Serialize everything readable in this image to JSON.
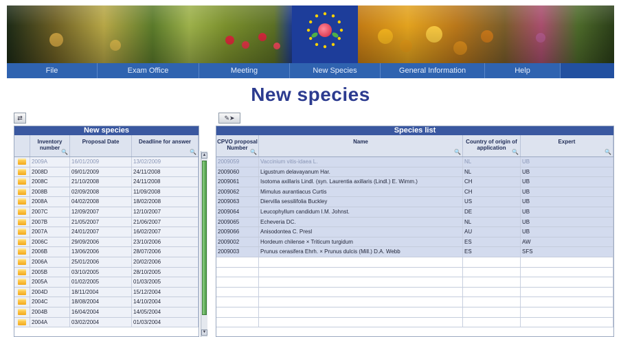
{
  "menu": [
    "File",
    "Exam Office",
    "Meeting",
    "New Species",
    "General Information",
    "Help"
  ],
  "page_title": "New species",
  "left_panel": {
    "title": "New species",
    "columns": [
      "Inventory number",
      "Proposal Date",
      "Deadline for answer"
    ],
    "selected_index": 0,
    "rows": [
      [
        "2009A",
        "16/01/2009",
        "13/02/2009"
      ],
      [
        "2008D",
        "09/01/2009",
        "24/11/2008"
      ],
      [
        "2008C",
        "21/10/2008",
        "24/11/2008"
      ],
      [
        "2008B",
        "02/09/2008",
        "11/09/2008"
      ],
      [
        "2008A",
        "04/02/2008",
        "18/02/2008"
      ],
      [
        "2007C",
        "12/09/2007",
        "12/10/2007"
      ],
      [
        "2007B",
        "21/05/2007",
        "21/06/2007"
      ],
      [
        "2007A",
        "24/01/2007",
        "16/02/2007"
      ],
      [
        "2006C",
        "29/09/2006",
        "23/10/2006"
      ],
      [
        "2006B",
        "13/06/2006",
        "28/07/2006"
      ],
      [
        "2006A",
        "25/01/2006",
        "20/02/2006"
      ],
      [
        "2005B",
        "03/10/2005",
        "28/10/2005"
      ],
      [
        "2005A",
        "01/02/2005",
        "01/03/2005"
      ],
      [
        "2004D",
        "18/11/2004",
        "15/12/2004"
      ],
      [
        "2004C",
        "18/08/2004",
        "14/10/2004"
      ],
      [
        "2004B",
        "16/04/2004",
        "14/05/2004"
      ],
      [
        "2004A",
        "03/02/2004",
        "01/03/2004"
      ]
    ]
  },
  "right_panel": {
    "title": "Species list",
    "columns": [
      "CPVO proposal Number",
      "Name",
      "Country of origin of application",
      "Expert"
    ],
    "selected_index": 0,
    "empty_rows": 7,
    "rows": [
      [
        "2009059",
        "Vaccinium vitis-idaea L.",
        "NL",
        "UB"
      ],
      [
        "2009060",
        "Ligustrum delavayanum Har.",
        "NL",
        "UB"
      ],
      [
        "2009061",
        "Isotoma axillaris Lindl. (syn. Laurentia axillaris (Lindl.) E. Wimm.)",
        "CH",
        "UB"
      ],
      [
        "2009062",
        "Mimulus aurantiacus Curtis",
        "CH",
        "UB"
      ],
      [
        "2009063",
        "Diervilla sessilifolia Buckley",
        "US",
        "UB"
      ],
      [
        "2009064",
        "Leucophyllum candidum I.M. Johnst.",
        "DE",
        "UB"
      ],
      [
        "2009065",
        "Echeveria DC.",
        "NL",
        "UB"
      ],
      [
        "2009066",
        "Anisodontea C. Presl",
        "AU",
        "UB"
      ],
      [
        "2009002",
        "Hordeum chilense × Triticum turgidum",
        "ES",
        "AW"
      ],
      [
        "2009003",
        "Prunus cerasifera Ehrh. × Prunus dulcis (Mill.) D.A. Webb",
        "ES",
        "SFS"
      ]
    ]
  }
}
